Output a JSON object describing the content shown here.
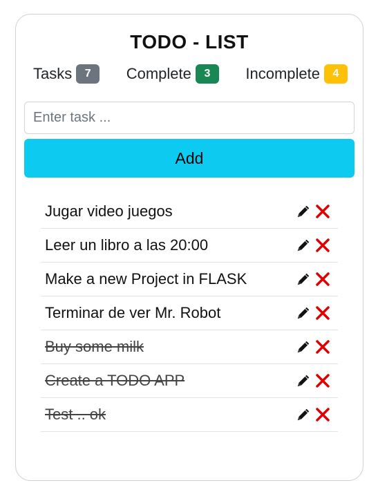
{
  "title": "TODO - LIST",
  "stats": [
    {
      "label": "Tasks",
      "count": "7",
      "color": "#6c757d"
    },
    {
      "label": "Complete",
      "count": "3",
      "color": "#198754"
    },
    {
      "label": "Incomplete",
      "count": "4",
      "color": "#ffc107"
    }
  ],
  "input": {
    "placeholder": "Enter task ...",
    "value": ""
  },
  "add_button": {
    "label": "Add",
    "color": "#0dcaf0"
  },
  "tasks": [
    {
      "text": "Jugar video juegos",
      "done": false
    },
    {
      "text": "Leer un libro a las 20:00",
      "done": false
    },
    {
      "text": "Make a new Project in FLASK",
      "done": false
    },
    {
      "text": "Terminar de ver Mr. Robot",
      "done": false
    },
    {
      "text": "Buy some milk",
      "done": true
    },
    {
      "text": "Create a TODO APP",
      "done": true
    },
    {
      "text": "Test .. ok",
      "done": true
    }
  ],
  "icons": {
    "edit": "pencil-icon",
    "delete": "close-icon",
    "delete_color": "#e00000"
  }
}
